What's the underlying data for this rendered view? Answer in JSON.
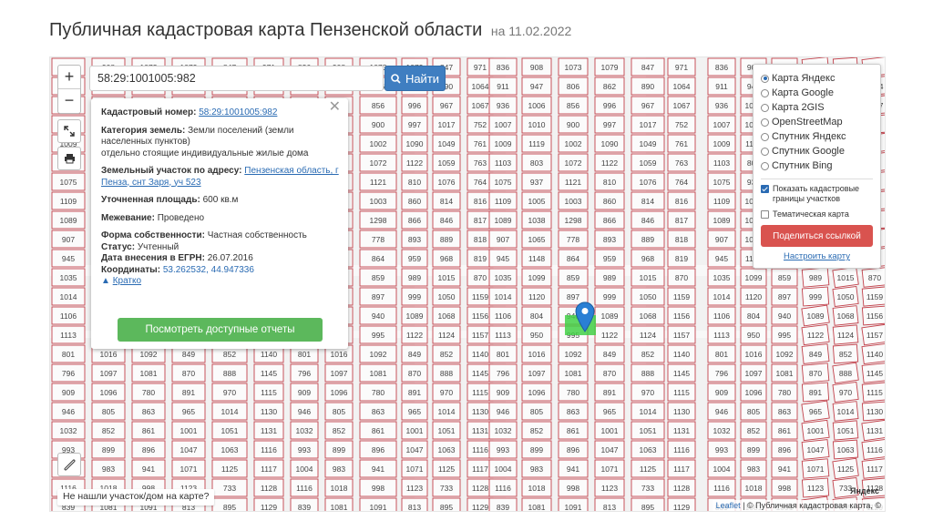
{
  "page": {
    "title": "Публичная кадастровая карта Пензенской области",
    "date": "на 11.02.2022"
  },
  "search": {
    "value": "58:29:1001005:982",
    "button_label": "Найти"
  },
  "controls": {
    "zoom_in": "+",
    "zoom_out": "−"
  },
  "popup": {
    "cad_label": "Кадастровый номер:",
    "cad_value": "58:29:1001005:982",
    "category_label": "Категория земель:",
    "category_value": "Земли поселений (земли населенных пунктов)",
    "use_value": "отдельно стоящие индивидуальные жилые дома",
    "address_label": "Земельный участок по адресу:",
    "address_value": "Пензенская область, г Пенза, снт Заря, уч 523",
    "area_label": "Уточненная площадь:",
    "area_value": "600 кв.м",
    "boundary_label": "Межевание:",
    "boundary_value": "Проведено",
    "ownership_label": "Форма собственности:",
    "ownership_value": "Частная собственность",
    "status_label": "Статус:",
    "status_value": "Учтенный",
    "egrn_label": "Дата внесения в ЕГРН:",
    "egrn_value": "26.07.2016",
    "coords_label": "Координаты:",
    "coords_value": "53.262532, 44.947336",
    "short_link": "Кратко",
    "reports_button": "Посмотреть доступные отчеты"
  },
  "layers": {
    "options": [
      {
        "label": "Карта Яндекс",
        "selected": true
      },
      {
        "label": "Карта Google",
        "selected": false
      },
      {
        "label": "Карта 2GIS",
        "selected": false
      },
      {
        "label": "OpenStreetMap",
        "selected": false
      },
      {
        "label": "Спутник Яндекс",
        "selected": false
      },
      {
        "label": "Спутник Google",
        "selected": false
      },
      {
        "label": "Спутник Bing",
        "selected": false
      }
    ],
    "show_borders": "Показать кадастровые границы участков",
    "thematic": "Тематическая карта",
    "share_button": "Поделиться ссылкой",
    "setup_link": "Настроить карту"
  },
  "map": {
    "not_found": "Не нашли участок/дом на карте?",
    "attribution_leaflet": "Leaflet",
    "attribution_rest": " | © Публичная кадастровая карта, ©",
    "yandex_logo": "Яндекс",
    "parcel_numbers": [
      "836",
      "911",
      "936",
      "1007",
      "1009",
      "1103",
      "1075",
      "1109",
      "1089",
      "907",
      "945",
      "1035",
      "1014",
      "1106",
      "1113",
      "801",
      "796",
      "909",
      "946",
      "1032",
      "993",
      "1004",
      "1116",
      "839",
      "908",
      "947",
      "1006",
      "1010",
      "1119",
      "803",
      "937",
      "1005",
      "1038",
      "1065",
      "1148",
      "1099",
      "1120",
      "804",
      "950",
      "1016",
      "1097",
      "1096",
      "805",
      "852",
      "899",
      "983",
      "1018",
      "1081",
      "1073",
      "806",
      "856",
      "900",
      "1002",
      "1072",
      "1121",
      "1003",
      "1298",
      "778",
      "864",
      "859",
      "897",
      "940",
      "995",
      "1092",
      "1081",
      "780",
      "863",
      "861",
      "896",
      "941",
      "998",
      "1091",
      "1079",
      "862",
      "996",
      "997",
      "1090",
      "1122",
      "810",
      "860",
      "866",
      "893",
      "959",
      "989",
      "999",
      "1089",
      "1122",
      "849",
      "870",
      "891",
      "965",
      "1001",
      "1047",
      "1071",
      "1123",
      "813",
      "847",
      "890",
      "967",
      "1017",
      "1049",
      "1059",
      "1076",
      "814",
      "846",
      "889",
      "968",
      "1015",
      "1050",
      "1068",
      "1124",
      "852",
      "888",
      "970",
      "1014",
      "1051",
      "1063",
      "1125",
      "733",
      "895",
      "971",
      "1064",
      "1067",
      "752",
      "761",
      "763",
      "764",
      "816",
      "817",
      "818",
      "819",
      "870",
      "1159",
      "1156",
      "1157",
      "1140",
      "1145",
      "1115",
      "1130",
      "1131",
      "1116",
      "1117",
      "1128",
      "1129"
    ]
  },
  "colors": {
    "parcel_stroke": "#c2414b",
    "selected_parcel": "#43d047",
    "marker": "#2a7fd4",
    "search_button": "#3f7ec1",
    "reports_button": "#5cb85c",
    "share_button": "#d9534f"
  }
}
